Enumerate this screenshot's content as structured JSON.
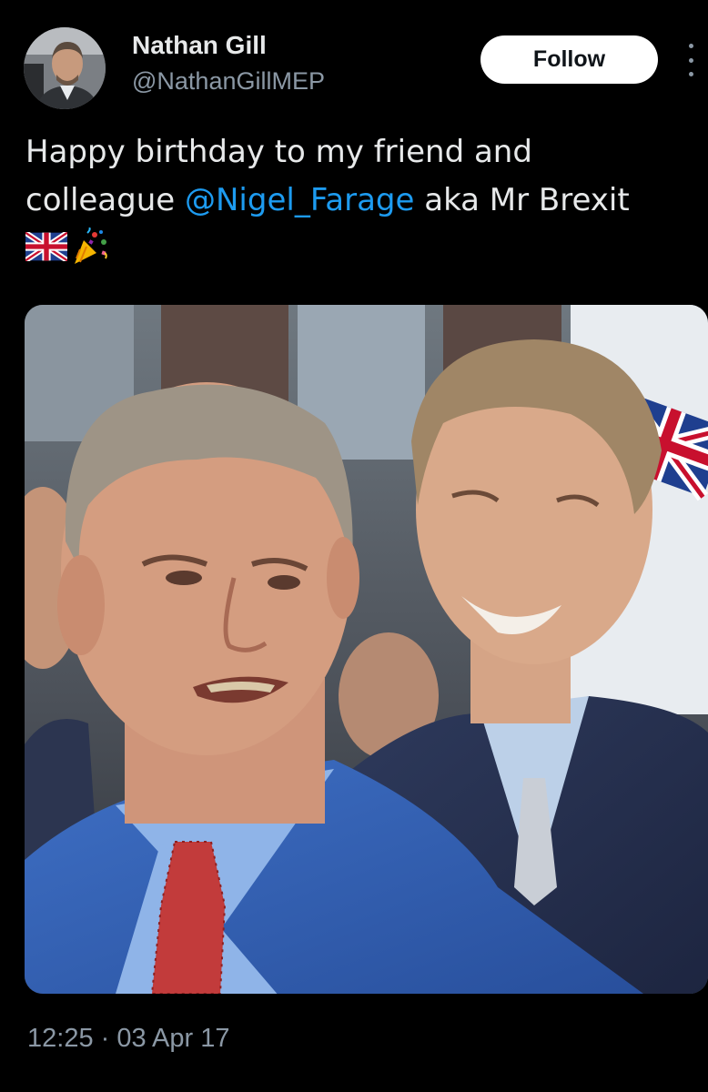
{
  "author": {
    "display_name": "Nathan Gill",
    "handle": "@NathanGillMEP",
    "avatar_icon": "profile-photo"
  },
  "actions": {
    "follow_label": "Follow",
    "more_icon": "more-vertical-icon"
  },
  "tweet": {
    "text_before_mention": "Happy birthday to my friend and colleague ",
    "mention": "@Nigel_Farage",
    "text_after_mention": " aka Mr Brexit",
    "emojis": [
      "uk-flag-emoji",
      "party-popper-emoji"
    ]
  },
  "media": {
    "type": "photo"
  },
  "meta": {
    "timestamp": "12:25 · 03 Apr 17"
  },
  "colors": {
    "background": "#000000",
    "primary_text": "#e7e9ea",
    "secondary_text": "#8b98a5",
    "link": "#1d9bf0",
    "follow_bg": "#ffffff"
  }
}
